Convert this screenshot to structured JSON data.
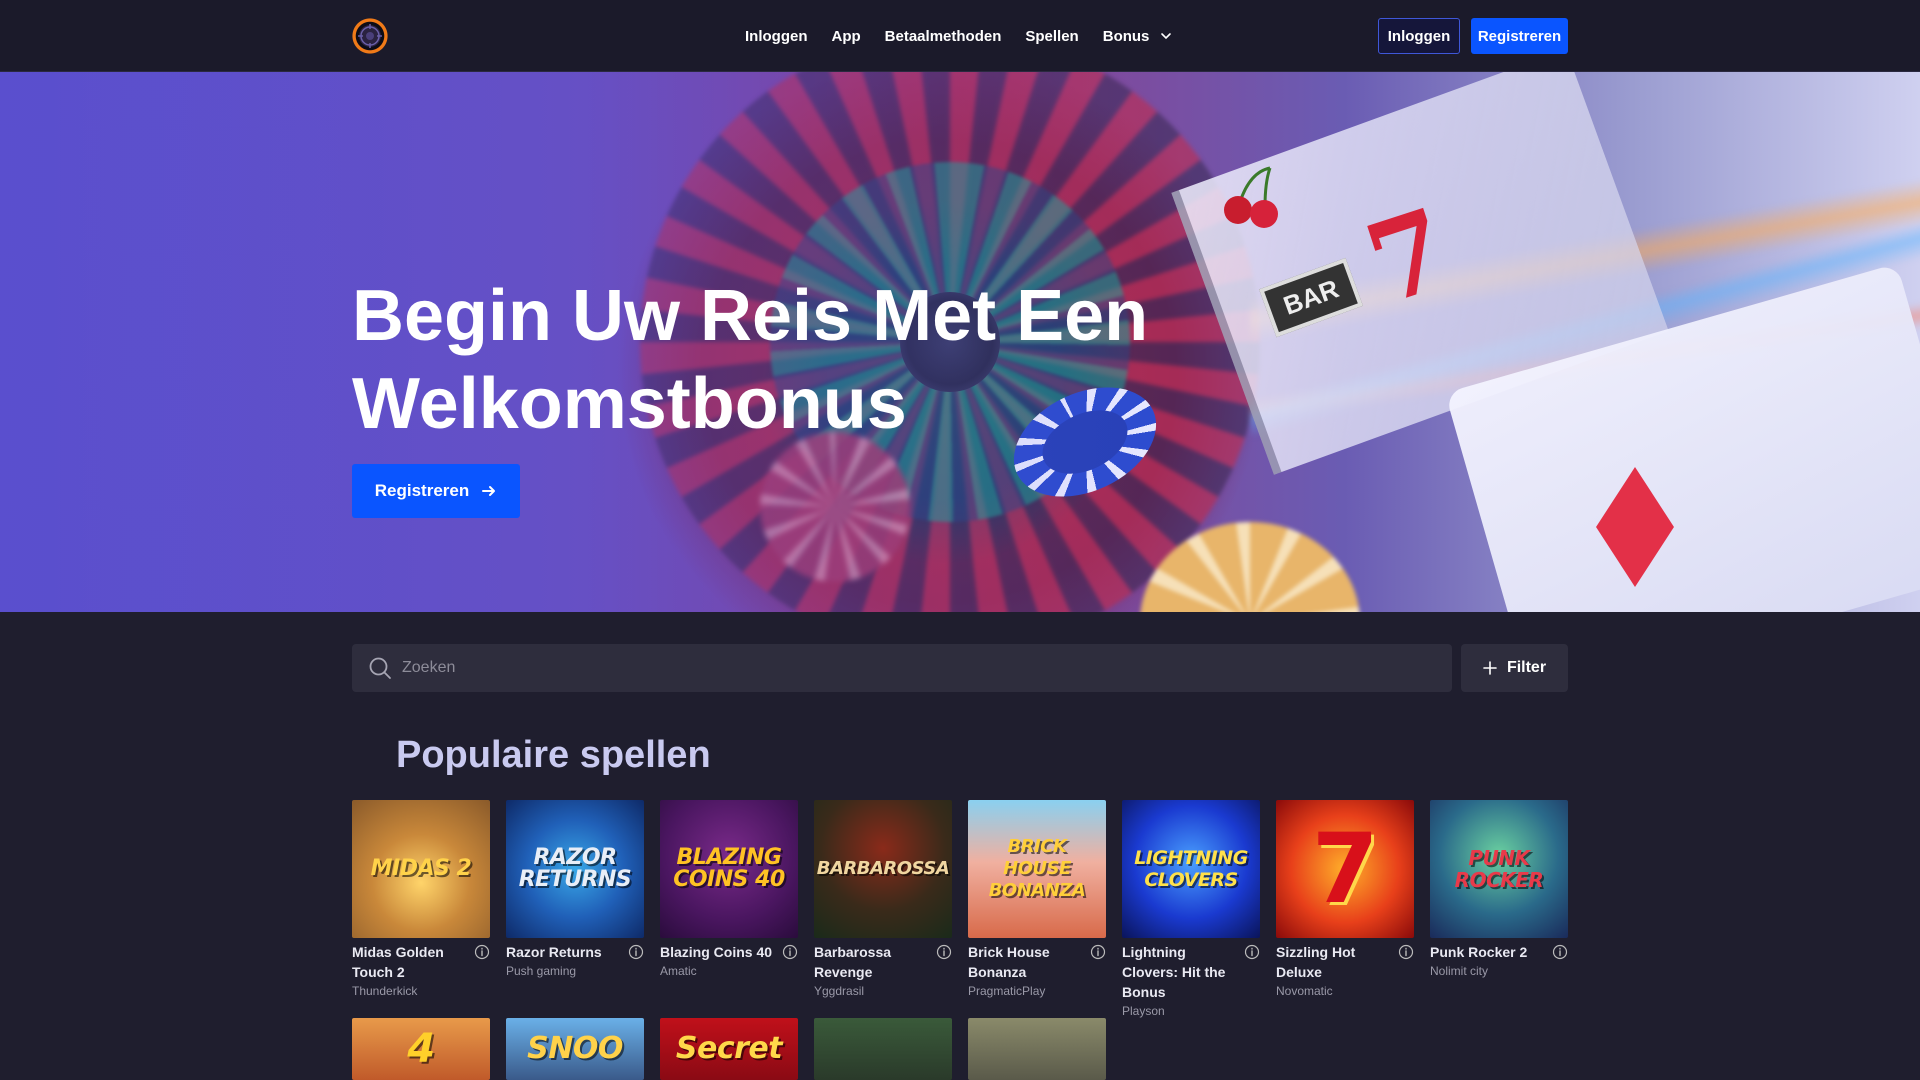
{
  "header": {
    "nav": [
      {
        "label": "Inloggen"
      },
      {
        "label": "App"
      },
      {
        "label": "Betaalmethoden"
      },
      {
        "label": "Spellen"
      },
      {
        "label": "Bonus"
      }
    ],
    "login_label": "Inloggen",
    "register_label": "Registreren",
    "accent": "#0a55ff"
  },
  "hero": {
    "title_line1": "Begin Uw Reis Met Een",
    "title_line2": "Welkomstbonus",
    "cta_label": "Registreren"
  },
  "search": {
    "placeholder": "Zoeken",
    "filter_label": "Filter"
  },
  "popular": {
    "title": "Populaire spellen",
    "games": [
      {
        "name": "Midas Golden Touch 2",
        "provider": "Thunderkick",
        "art": "MIDAS 2",
        "icon": "info-icon"
      },
      {
        "name": "Razor Returns",
        "provider": "Push gaming",
        "art": "RAZOR RETURNS",
        "icon": "info-icon"
      },
      {
        "name": "Blazing Coins 40",
        "provider": "Amatic",
        "art": "BLAZING COINS 40",
        "icon": "info-icon"
      },
      {
        "name": "Barbarossa Revenge",
        "provider": "Yggdrasil",
        "art": "BARBAROSSA",
        "icon": "info-icon"
      },
      {
        "name": "Brick House Bonanza",
        "provider": "PragmaticPlay",
        "art": "BRICK HOUSE BONANZA",
        "icon": "info-icon"
      },
      {
        "name": "Lightning Clovers: Hit the Bonus",
        "provider": "Playson",
        "art": "LIGHTNING CLOVERS",
        "icon": "info-icon"
      },
      {
        "name": "Sizzling Hot Deluxe",
        "provider": "Novomatic",
        "art": "7",
        "icon": "info-icon"
      },
      {
        "name": "Punk Rocker 2",
        "provider": "Nolimit city",
        "art": "PUNK ROCKER",
        "icon": "info-icon"
      }
    ],
    "row2_art": [
      "4",
      "SNOO",
      "Secret",
      "",
      ""
    ]
  }
}
